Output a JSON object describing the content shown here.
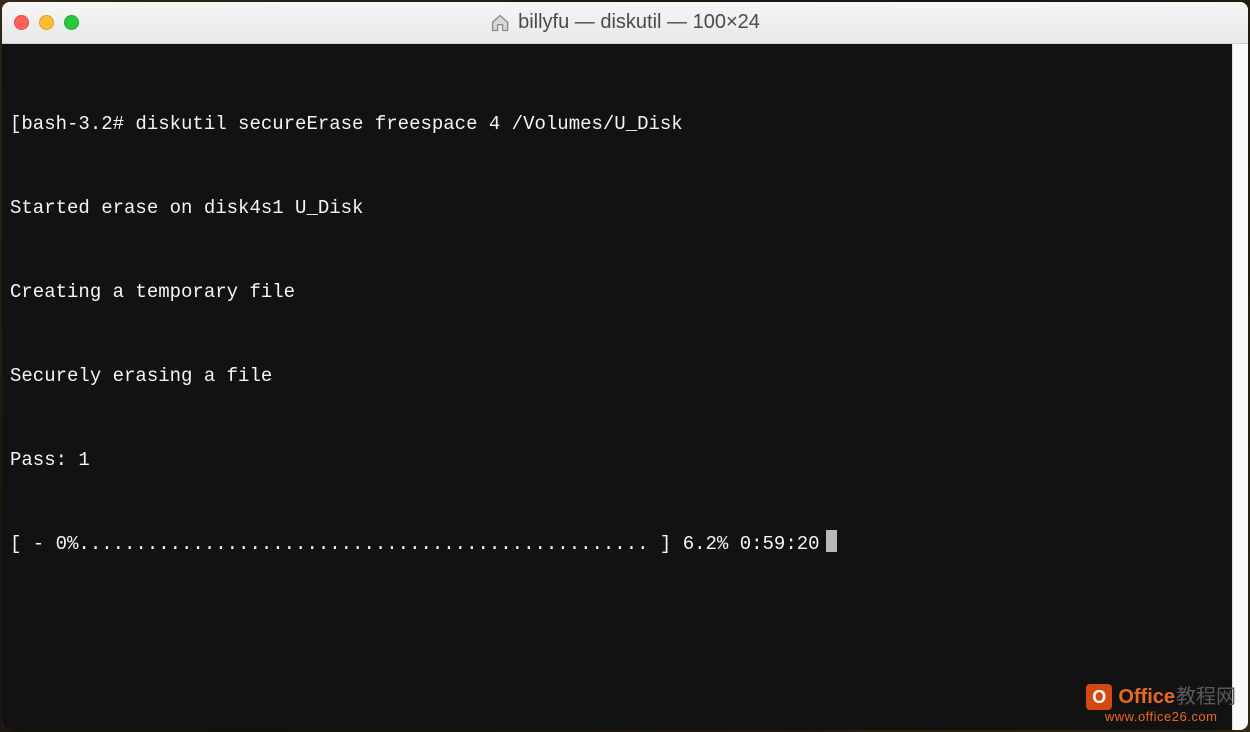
{
  "window": {
    "title": "billyfu — diskutil — 100×24"
  },
  "terminal": {
    "prompt": "[bash-3.2# ",
    "command": "diskutil secureErase freespace 4 /Volumes/U_Disk",
    "output": {
      "line1": "Started erase on disk4s1 U_Disk",
      "line2": "Creating a temporary file",
      "line3": "Securely erasing a file",
      "line4": "Pass: 1",
      "progress": "[ - 0%.................................................. ] 6.2% 0:59:20"
    }
  },
  "watermark": {
    "brand1": "Office",
    "brand2": "教程网",
    "url": "www.office26.com"
  }
}
